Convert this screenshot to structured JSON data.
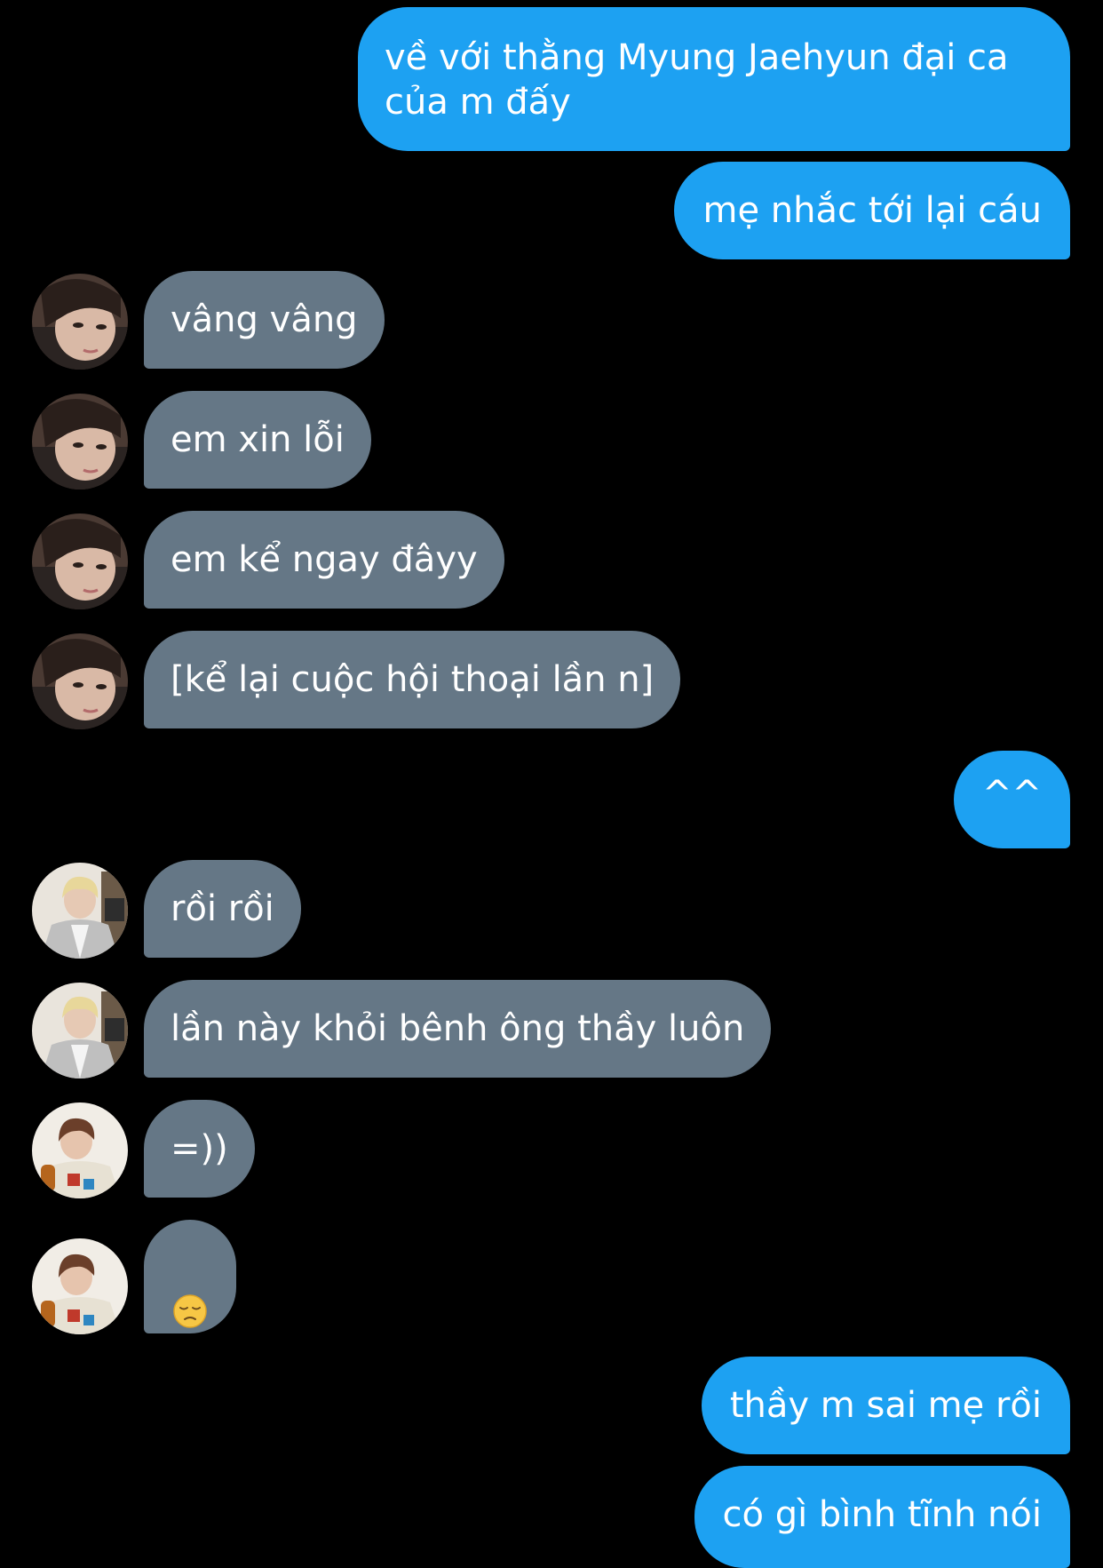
{
  "messages": [
    {
      "text": "về với thằng Myung Jaehyun đại ca của m đấy"
    },
    {
      "text": "mẹ nhắc tới lại cáu"
    },
    {
      "text": "vâng vâng"
    },
    {
      "text": "em xin lỗi"
    },
    {
      "text": "em kể ngay đâyy"
    },
    {
      "text": "[kể lại cuộc hội thoại lần n]"
    },
    {
      "text": "^^"
    },
    {
      "text": "rồi rồi"
    },
    {
      "text": "lần này khỏi bênh ông thầy luôn"
    },
    {
      "text": "=))"
    },
    {
      "emoji": "pensive-face"
    },
    {
      "text": "thầy m sai mẹ rồi"
    },
    {
      "text": "có gì bình tĩnh nói"
    }
  ],
  "colors": {
    "background": "#000000",
    "outgoing_bubble": "#1da1f2",
    "incoming_bubble": "#657786",
    "text": "#ffffff"
  }
}
